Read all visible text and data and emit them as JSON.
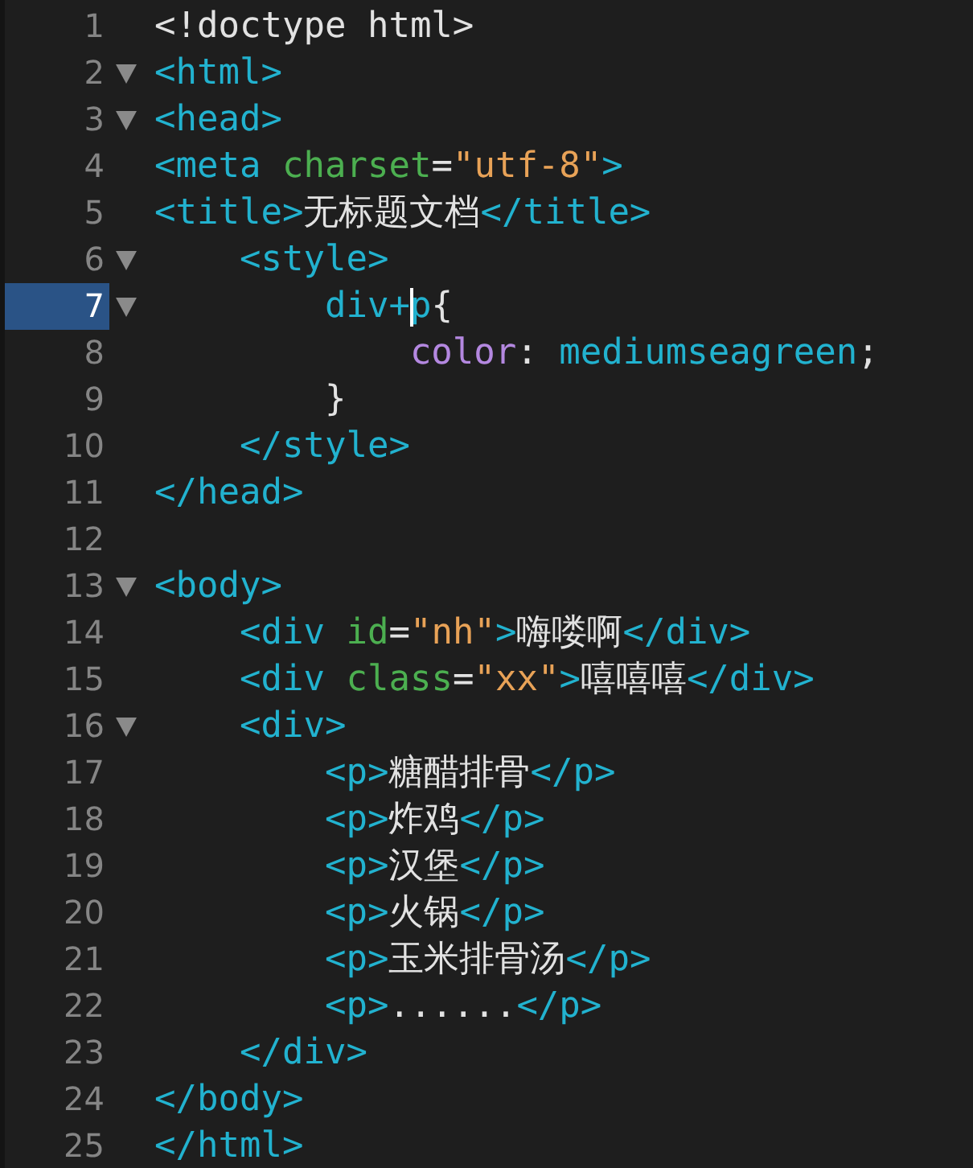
{
  "editor": {
    "lines": [
      {
        "number": "1",
        "fold": false,
        "current": false,
        "tokens": [
          {
            "kind": "text",
            "text": "<!doctype html>"
          }
        ]
      },
      {
        "number": "2",
        "fold": true,
        "current": false,
        "tokens": [
          {
            "kind": "tag",
            "text": "<html>"
          }
        ]
      },
      {
        "number": "3",
        "fold": true,
        "current": false,
        "tokens": [
          {
            "kind": "tag",
            "text": "<head>"
          }
        ]
      },
      {
        "number": "4",
        "fold": false,
        "current": false,
        "tokens": [
          {
            "kind": "tag",
            "text": "<meta "
          },
          {
            "kind": "attr",
            "text": "charset"
          },
          {
            "kind": "text",
            "text": "="
          },
          {
            "kind": "string",
            "text": "\"utf-8\""
          },
          {
            "kind": "tag",
            "text": ">"
          }
        ]
      },
      {
        "number": "5",
        "fold": false,
        "current": false,
        "tokens": [
          {
            "kind": "tag",
            "text": "<title>"
          },
          {
            "kind": "text",
            "text": "无标题文档"
          },
          {
            "kind": "tag",
            "text": "</title>"
          }
        ]
      },
      {
        "number": "6",
        "fold": true,
        "current": false,
        "tokens": [
          {
            "kind": "tag",
            "text": "    <style>"
          }
        ]
      },
      {
        "number": "7",
        "fold": true,
        "current": true,
        "tokens": [
          {
            "kind": "tag",
            "text": "        div+"
          },
          {
            "kind": "caret"
          },
          {
            "kind": "tag",
            "text": "p"
          },
          {
            "kind": "text",
            "text": "{"
          }
        ]
      },
      {
        "number": "8",
        "fold": false,
        "current": false,
        "tokens": [
          {
            "kind": "prop",
            "text": "            color"
          },
          {
            "kind": "text",
            "text": ": "
          },
          {
            "kind": "tag",
            "text": "mediumseagreen"
          },
          {
            "kind": "text",
            "text": ";"
          }
        ]
      },
      {
        "number": "9",
        "fold": false,
        "current": false,
        "tokens": [
          {
            "kind": "text",
            "text": "        }"
          }
        ]
      },
      {
        "number": "10",
        "fold": false,
        "current": false,
        "tokens": [
          {
            "kind": "tag",
            "text": "    </style>"
          }
        ]
      },
      {
        "number": "11",
        "fold": false,
        "current": false,
        "tokens": [
          {
            "kind": "tag",
            "text": "</head>"
          }
        ]
      },
      {
        "number": "12",
        "fold": false,
        "current": false
      },
      {
        "number": "13",
        "fold": true,
        "current": false,
        "tokens": [
          {
            "kind": "tag",
            "text": "<body>"
          }
        ]
      },
      {
        "number": "14",
        "fold": false,
        "current": false,
        "tokens": [
          {
            "kind": "tag",
            "text": "    <div "
          },
          {
            "kind": "attr",
            "text": "id"
          },
          {
            "kind": "text",
            "text": "="
          },
          {
            "kind": "string",
            "text": "\"nh\""
          },
          {
            "kind": "tag",
            "text": ">"
          },
          {
            "kind": "text",
            "text": "嗨喽啊"
          },
          {
            "kind": "tag",
            "text": "</div>"
          }
        ]
      },
      {
        "number": "15",
        "fold": false,
        "current": false,
        "tokens": [
          {
            "kind": "tag",
            "text": "    <div "
          },
          {
            "kind": "attr",
            "text": "class"
          },
          {
            "kind": "text",
            "text": "="
          },
          {
            "kind": "string",
            "text": "\"xx\""
          },
          {
            "kind": "tag",
            "text": ">"
          },
          {
            "kind": "text",
            "text": "嘻嘻嘻"
          },
          {
            "kind": "tag",
            "text": "</div>"
          }
        ]
      },
      {
        "number": "16",
        "fold": true,
        "current": false,
        "tokens": [
          {
            "kind": "tag",
            "text": "    <div>"
          }
        ]
      },
      {
        "number": "17",
        "fold": false,
        "current": false,
        "tokens": [
          {
            "kind": "tag",
            "text": "        <p>"
          },
          {
            "kind": "text",
            "text": "糖醋排骨"
          },
          {
            "kind": "tag",
            "text": "</p>"
          }
        ]
      },
      {
        "number": "18",
        "fold": false,
        "current": false,
        "tokens": [
          {
            "kind": "tag",
            "text": "        <p>"
          },
          {
            "kind": "text",
            "text": "炸鸡"
          },
          {
            "kind": "tag",
            "text": "</p>"
          }
        ]
      },
      {
        "number": "19",
        "fold": false,
        "current": false,
        "tokens": [
          {
            "kind": "tag",
            "text": "        <p>"
          },
          {
            "kind": "text",
            "text": "汉堡"
          },
          {
            "kind": "tag",
            "text": "</p>"
          }
        ]
      },
      {
        "number": "20",
        "fold": false,
        "current": false,
        "tokens": [
          {
            "kind": "tag",
            "text": "        <p>"
          },
          {
            "kind": "text",
            "text": "火锅"
          },
          {
            "kind": "tag",
            "text": "</p>"
          }
        ]
      },
      {
        "number": "21",
        "fold": false,
        "current": false,
        "tokens": [
          {
            "kind": "tag",
            "text": "        <p>"
          },
          {
            "kind": "text",
            "text": "玉米排骨汤"
          },
          {
            "kind": "tag",
            "text": "</p>"
          }
        ]
      },
      {
        "number": "22",
        "fold": false,
        "current": false,
        "tokens": [
          {
            "kind": "tag",
            "text": "        <p>"
          },
          {
            "kind": "text",
            "text": "......"
          },
          {
            "kind": "tag",
            "text": "</p>"
          }
        ]
      },
      {
        "number": "23",
        "fold": false,
        "current": false,
        "tokens": [
          {
            "kind": "tag",
            "text": "    </div>"
          }
        ]
      },
      {
        "number": "24",
        "fold": false,
        "current": false,
        "tokens": [
          {
            "kind": "tag",
            "text": "</body>"
          }
        ]
      },
      {
        "number": "25",
        "fold": false,
        "current": false,
        "tokens": [
          {
            "kind": "tag",
            "text": "</html>"
          }
        ]
      }
    ]
  }
}
